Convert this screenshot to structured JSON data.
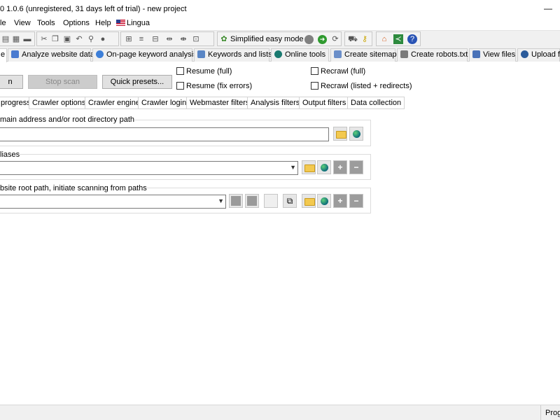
{
  "window": {
    "title": "0 1.0.6 (unregistered, 31 days left of trial) - new project",
    "minimize_glyph": "—"
  },
  "menu": {
    "items": [
      "le",
      "View",
      "Tools",
      "Options",
      "Help"
    ],
    "language": "Lingua"
  },
  "toolbar": {
    "mode_label": "Simplified easy mode",
    "icons": [
      "open-icon",
      "save-icon",
      "print-icon",
      "cut-icon",
      "copy-icon",
      "paste-icon",
      "undo-icon",
      "find-icon",
      "comment-icon",
      "tree-icon",
      "tree-expand-icon",
      "tree-collapse-icon",
      "tree-lines-icon",
      "mode-icon",
      "stop-icon",
      "go-icon",
      "refresh-icon",
      "cart-icon",
      "key-icon",
      "home-icon",
      "share-icon",
      "help-icon"
    ]
  },
  "main_tabs": [
    {
      "label": "e",
      "icon": "scan-icon"
    },
    {
      "label": "Analyze website data",
      "icon": "analyze-icon"
    },
    {
      "label": "On-page keyword analysis",
      "icon": "keyword-analysis-icon"
    },
    {
      "label": "Keywords and lists",
      "icon": "list-icon"
    },
    {
      "label": "Online tools",
      "icon": "globe-icon"
    },
    {
      "label": "Create sitemap",
      "icon": "sitemap-icon"
    },
    {
      "label": "Create robots.txt",
      "icon": "filter-icon"
    },
    {
      "label": "View files",
      "icon": "files-icon"
    },
    {
      "label": "Upload fi",
      "icon": "upload-icon"
    }
  ],
  "scan_controls": {
    "start_label": "n",
    "stop_label": "Stop scan",
    "presets_label": "Quick presets...",
    "checkboxes": [
      {
        "label": "Resume (full)",
        "checked": false
      },
      {
        "label": "Resume (fix errors)",
        "checked": false
      },
      {
        "label": "Recrawl (full)",
        "checked": false
      },
      {
        "label": "Recrawl (listed + redirects)",
        "checked": false
      }
    ]
  },
  "sub_tabs": [
    "progress",
    "Crawler options",
    "Crawler engine",
    "Crawler login",
    "Webmaster filters",
    "Analysis filters",
    "Output filters",
    "Data collection"
  ],
  "groups": {
    "domain": {
      "label": "main address and/or root directory path",
      "value": ""
    },
    "aliases": {
      "label": "liases",
      "value": ""
    },
    "root_paths": {
      "label": "bsite root path, initiate scanning from paths",
      "value": ""
    }
  },
  "status": {
    "right_pane": "Prog"
  }
}
